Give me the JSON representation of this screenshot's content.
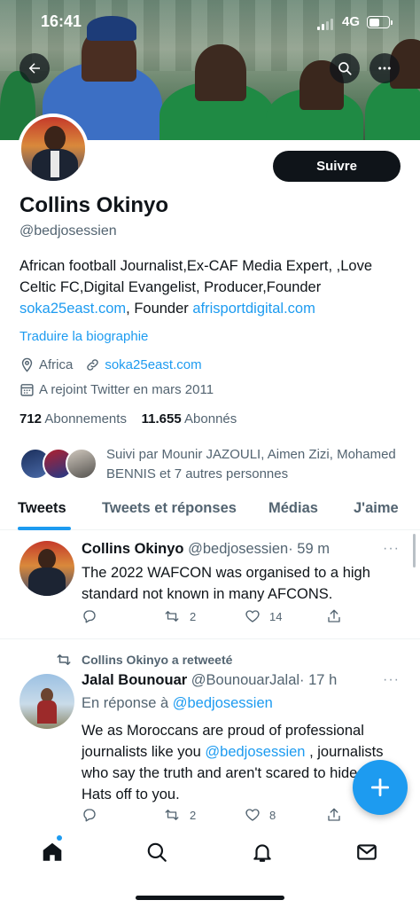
{
  "status_bar": {
    "time": "16:41",
    "network": "4G",
    "battery_level": 0.55
  },
  "header": {
    "back_icon": "arrow-left-icon",
    "search_icon": "search-icon",
    "more_icon": "ellipsis-icon"
  },
  "profile": {
    "name": "Collins Okinyo",
    "handle": "@bedjosessien",
    "follow_label": "Suivre",
    "bio_text_1": "African football Journalist,Ex-CAF Media Expert, ,Love Celtic FC,Digital Evangelist, Producer,Founder ",
    "bio_link_1": "soka25east.com",
    "bio_text_2": ", Founder ",
    "bio_link_2": "afrisportdigital.com",
    "translate_label": "Traduire la biographie",
    "location": "Africa",
    "website": "soka25east.com",
    "joined": "A rejoint Twitter en mars 2011",
    "following_count": "712",
    "following_label": "Abonnements",
    "followers_count": "11.655",
    "followers_label": "Abonnés",
    "followed_by": "Suivi par Mounir JAZOULI, Aimen Zizi, Mohamed BENNIS et 7 autres personnes"
  },
  "tabs": [
    {
      "label": "Tweets",
      "active": true
    },
    {
      "label": "Tweets et réponses",
      "active": false
    },
    {
      "label": "Médias",
      "active": false
    },
    {
      "label": "J'aime",
      "active": false
    }
  ],
  "tweets": [
    {
      "author": "Collins Okinyo",
      "handle": "@bedjosessien",
      "time": "· 59 m",
      "more": "···",
      "text": "The 2022 WAFCON was  organised to a high standard not known in many AFCONS.",
      "replies": "",
      "retweets": "2",
      "likes": "14"
    },
    {
      "retweeted_by": "Collins Okinyo a retweeté",
      "author": "Jalal Bounouar",
      "handle": "@BounouarJalal",
      "time": "· 17 h",
      "more": "···",
      "reply_prefix": "En réponse à ",
      "reply_to": "@bedjosessien",
      "text_1": "We as Moroccans are proud of professional journalists like you ",
      "text_mention": "@bedjosessien",
      "text_2": " , journalists who say the truth and aren't scared to hide it. Hats off to you.",
      "replies": "",
      "retweets": "2",
      "likes": "8"
    }
  ],
  "fab_icon": "plus-icon",
  "bottom_nav": [
    {
      "icon": "home-icon"
    },
    {
      "icon": "search-icon"
    },
    {
      "icon": "bell-icon"
    },
    {
      "icon": "mail-icon"
    }
  ],
  "colors": {
    "accent": "#1d9bf0",
    "text": "#0f1419",
    "muted": "#536471"
  }
}
